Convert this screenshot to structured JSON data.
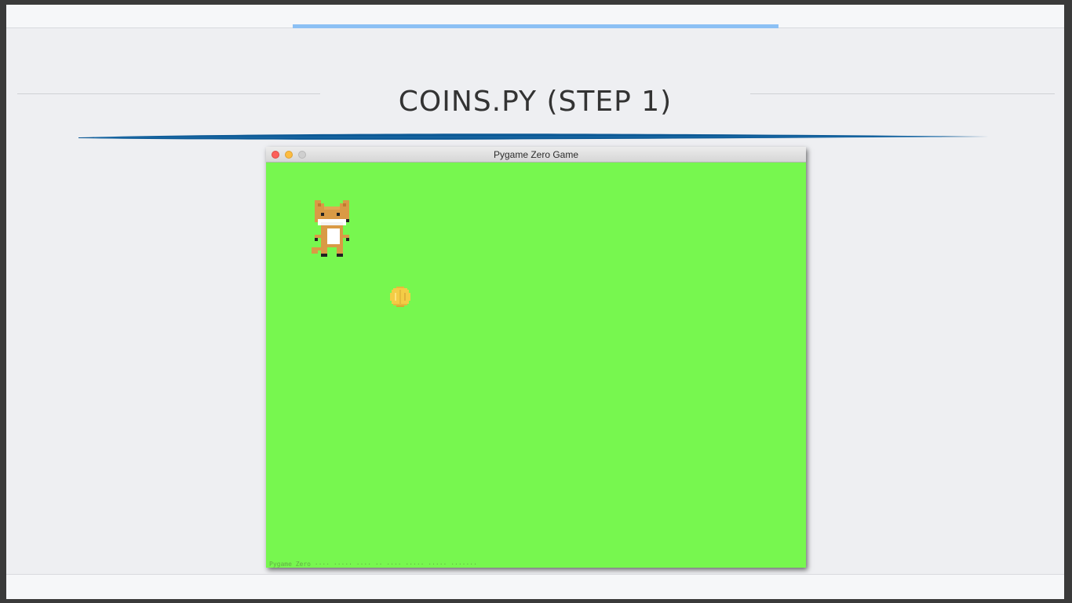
{
  "slide": {
    "title": "COINS.PY (STEP 1)"
  },
  "game_window": {
    "title": "Pygame Zero Game",
    "status_text": "Pygame Zero ···· ····· ···· ·· ···· ····· ····· ·······",
    "canvas_color": "#77f74f"
  },
  "sprites": [
    {
      "name": "fox-sprite",
      "label": "fox"
    },
    {
      "name": "coin-sprite",
      "label": "coin"
    }
  ],
  "colors": {
    "accent_blue": "#8cc0f4",
    "brush_blue": "#0d5a96",
    "title_text": "#333333",
    "fox_orange": "#d99a45",
    "coin_gold": "#f4cc45"
  }
}
